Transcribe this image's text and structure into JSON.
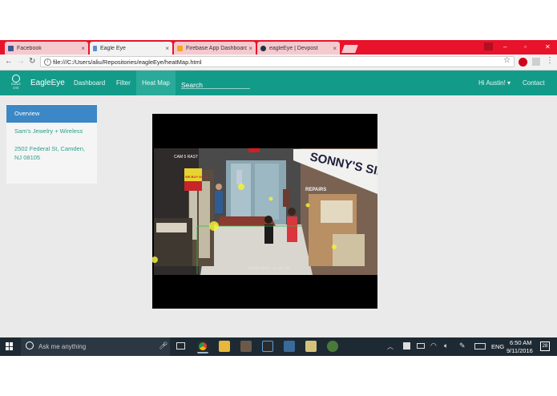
{
  "browser": {
    "tabs": [
      {
        "title": "Facebook",
        "favicon_color": "#3b5998",
        "active": false
      },
      {
        "title": "Eagle Eye",
        "favicon_color": "#5b8fd0",
        "active": true
      },
      {
        "title": "Firebase App Dashboard",
        "favicon_color": "#f5a623",
        "active": false
      },
      {
        "title": "eagleEye | Devpost",
        "favicon_color": "#1f3440",
        "active": false
      }
    ],
    "close_glyph": "×",
    "url": "file:///C:/Users/aliu/Repositories/eagleEye/heatMap.html",
    "window_controls": {
      "minimize": "–",
      "maximize": "▫",
      "close": "✕"
    }
  },
  "navbar": {
    "brand": "EagleEye",
    "logo_text": "EAGLE EYE",
    "links": [
      "Dashboard",
      "Filter",
      "Heat Map"
    ],
    "active_link": "Heat Map",
    "search_placeholder": "Search",
    "user_menu": "Hi Austin!",
    "contact": "Contact"
  },
  "sidebar": {
    "active_item": "Overview",
    "store_name": "Sam's Jewelry + Wireless",
    "address_line1": "2502 Federal St, Camden,",
    "address_line2": "NJ 08105"
  },
  "video": {
    "store_sign": "SONNY'S SIL",
    "sign_repairs": "REPAIRS",
    "sign_buy": "WE BUY GOLD",
    "camera_label": "CAM 5 RAST",
    "timestamp": "04/19/2013 12:43:35"
  },
  "taskbar": {
    "search_placeholder": "Ask me anything",
    "lang": "ENG",
    "time": "6:50 AM",
    "date": "9/11/2016",
    "notification_count": "28"
  },
  "colors": {
    "accent": "#139b8a",
    "sidebar_active": "#3c87c6",
    "link": "#2ca08d",
    "chrome_red": "#e8132b",
    "taskbar": "#1e2a33"
  }
}
